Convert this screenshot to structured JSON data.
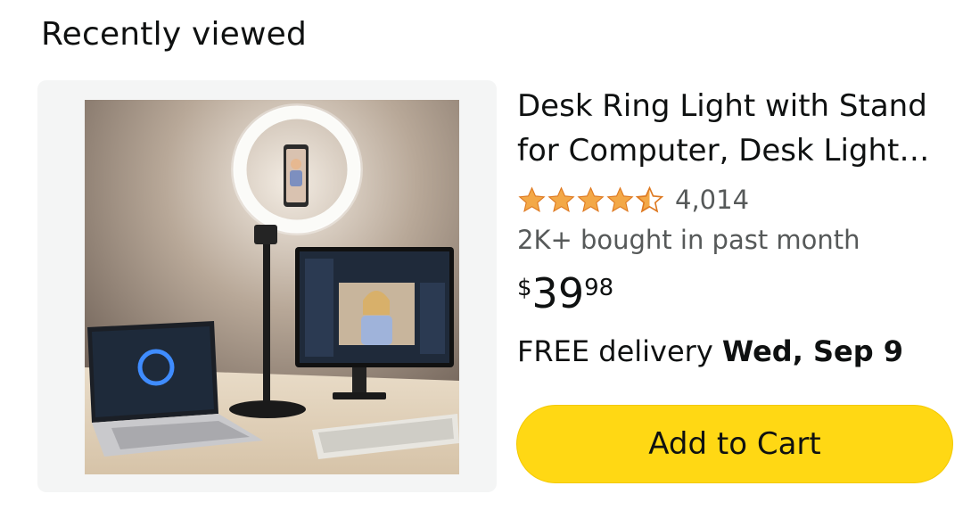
{
  "section": {
    "title": "Recently viewed"
  },
  "product": {
    "title": "Desk Ring Light with Stand for Computer, Desk Light for Video Conference",
    "rating": {
      "stars": 4.5,
      "count_label": "4,014"
    },
    "social_proof": "2K+ bought in past month",
    "price": {
      "symbol": "$",
      "whole": "39",
      "fraction": "98"
    },
    "delivery": {
      "prefix": "FREE delivery ",
      "date": "Wed, Sep 9"
    },
    "add_to_cart_label": "Add to Cart"
  },
  "colors": {
    "star": "#f3a847",
    "button": "#ffd814",
    "muted_text": "#565959"
  }
}
